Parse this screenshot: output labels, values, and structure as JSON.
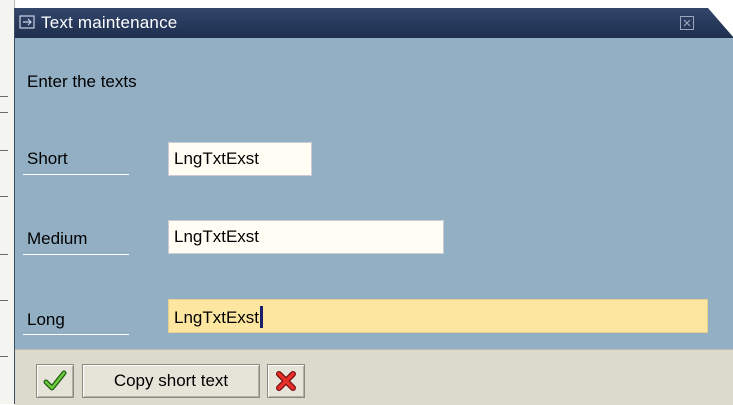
{
  "dialog": {
    "title": "Text maintenance",
    "prompt": "Enter the texts",
    "fields": [
      {
        "label": "Short",
        "value": "LngTxtExst"
      },
      {
        "label": "Medium",
        "value": "LngTxtExst"
      },
      {
        "label": "Long",
        "value": "LngTxtExst"
      }
    ],
    "buttons": {
      "confirm_icon": "green-checkmark-icon",
      "copy_short_text": "Copy short text",
      "cancel_icon": "red-x-icon"
    }
  },
  "colors": {
    "dialog_background": "#92afc4",
    "titlebar": "#26385a",
    "active_field": "#fde6a0",
    "footer": "#dcdacd"
  }
}
